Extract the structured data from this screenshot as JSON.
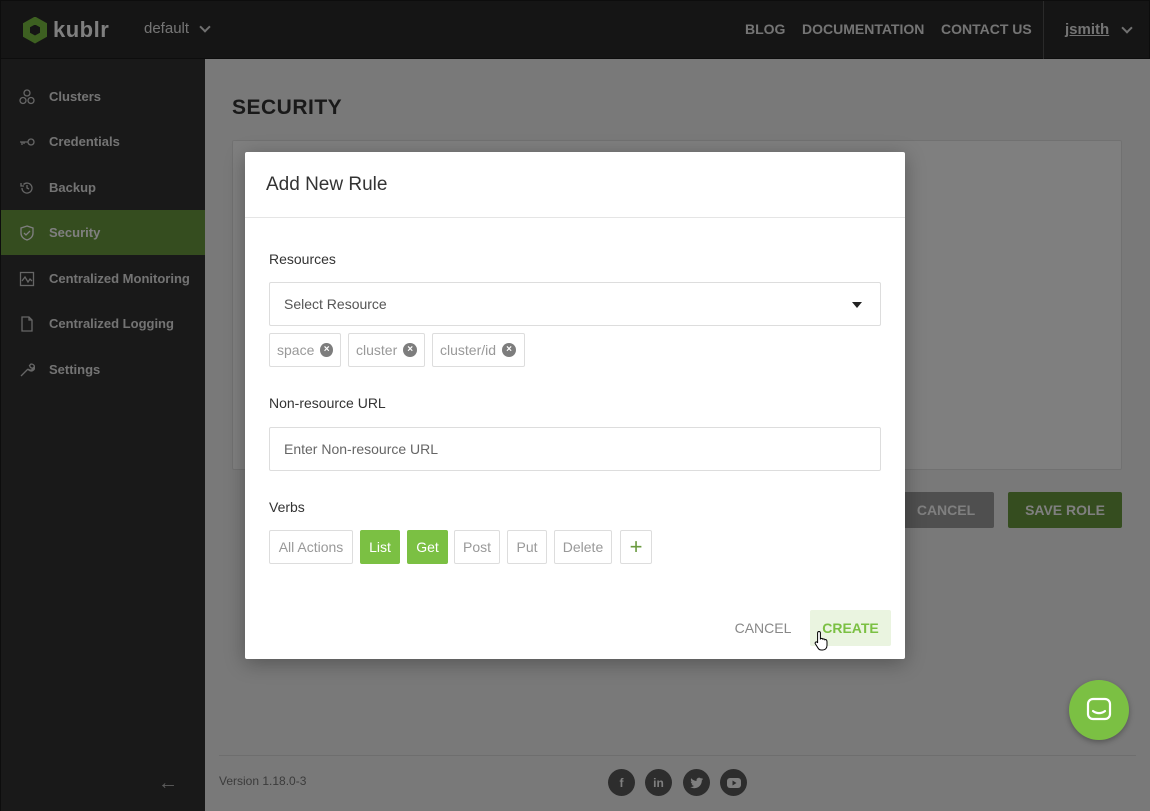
{
  "app": {
    "brand": "kublr",
    "space": "default"
  },
  "topnav": {
    "blog": "BLOG",
    "documentation": "DOCUMENTATION",
    "contact": "CONTACT US",
    "user": "jsmith"
  },
  "sidebar": {
    "items": [
      {
        "label": "Clusters",
        "icon": "clusters-icon"
      },
      {
        "label": "Credentials",
        "icon": "key-icon"
      },
      {
        "label": "Backup",
        "icon": "backup-icon"
      },
      {
        "label": "Security",
        "icon": "shield-icon",
        "active": true
      },
      {
        "label": "Centralized Monitoring",
        "icon": "monitoring-icon"
      },
      {
        "label": "Centralized Logging",
        "icon": "document-icon"
      },
      {
        "label": "Settings",
        "icon": "wrench-icon"
      }
    ]
  },
  "main": {
    "title": "SECURITY",
    "cancel_label": "CANCEL",
    "save_label": "SAVE ROLE"
  },
  "footer": {
    "version": "Version 1.18.0-3",
    "social": [
      "facebook-icon",
      "linkedin-icon",
      "twitter-icon",
      "youtube-icon"
    ]
  },
  "modal": {
    "title": "Add New Rule",
    "resources_label": "Resources",
    "resource_placeholder": "Select Resource",
    "resources": [
      "space",
      "cluster",
      "cluster/id"
    ],
    "url_label": "Non-resource URL",
    "url_placeholder": "Enter Non-resource URL",
    "verbs_label": "Verbs",
    "verbs": [
      {
        "label": "All Actions",
        "selected": false
      },
      {
        "label": "List",
        "selected": true
      },
      {
        "label": "Get",
        "selected": true
      },
      {
        "label": "Post",
        "selected": false
      },
      {
        "label": "Put",
        "selected": false
      },
      {
        "label": "Delete",
        "selected": false
      }
    ],
    "cancel_label": "CANCEL",
    "create_label": "CREATE"
  },
  "colors": {
    "accent": "#7bc043",
    "accent_dark": "#6a9a3f",
    "topbar": "#2b2b2b",
    "sidebar": "#333333"
  }
}
